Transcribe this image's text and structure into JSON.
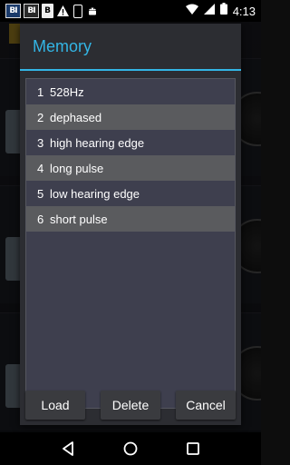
{
  "status_bar": {
    "time": "4:13",
    "notification_icons": [
      "bi-app-icon",
      "bi-app-icon",
      "b-app-icon",
      "warning-icon",
      "device-icon",
      "android-icon"
    ],
    "labels": {
      "bi": "BI",
      "b": "B"
    }
  },
  "dialog": {
    "title": "Memory",
    "items": [
      {
        "num": "1",
        "label": "528Hz"
      },
      {
        "num": "2",
        "label": "dephased"
      },
      {
        "num": "3",
        "label": "high hearing edge"
      },
      {
        "num": "4",
        "label": "long pulse"
      },
      {
        "num": "5",
        "label": "low hearing edge"
      },
      {
        "num": "6",
        "label": "short pulse"
      }
    ],
    "buttons": {
      "load": "Load",
      "delete": "Delete",
      "cancel": "Cancel"
    }
  },
  "colors": {
    "accent": "#33b5e5",
    "dialog_bg": "#2c2d32",
    "list_bg": "#3e3f4e",
    "list_alt_bg": "#5a5b5e"
  }
}
